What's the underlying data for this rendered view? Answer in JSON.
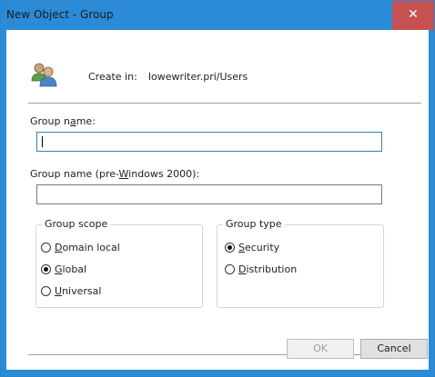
{
  "window": {
    "title": "New Object - Group",
    "close_symbol": "✕"
  },
  "header": {
    "icon": "users-group-icon",
    "create_in_label": "Create in:",
    "create_in_path": "lowewriter.pri/Users"
  },
  "group_name": {
    "label_pre": "Group n",
    "label_u": "a",
    "label_post": "me:",
    "value": ""
  },
  "group_name_pre2000": {
    "label_pre": "Group name (pre-",
    "label_u": "W",
    "label_post": "indows 2000):",
    "value": ""
  },
  "group_scope": {
    "title": "Group scope",
    "options": [
      {
        "pre": "",
        "u": "D",
        "post": "omain local",
        "checked": false
      },
      {
        "pre": "",
        "u": "G",
        "post": "lobal",
        "checked": true
      },
      {
        "pre": "",
        "u": "U",
        "post": "niversal",
        "checked": false
      }
    ]
  },
  "group_type": {
    "title": "Group type",
    "options": [
      {
        "pre": "",
        "u": "S",
        "post": "ecurity",
        "checked": true
      },
      {
        "pre": "",
        "u": "D",
        "post": "istribution",
        "checked": false
      }
    ]
  },
  "buttons": {
    "ok": "OK",
    "cancel": "Cancel"
  },
  "colors": {
    "titlebar": "#2b8bd6",
    "close": "#c75050"
  }
}
